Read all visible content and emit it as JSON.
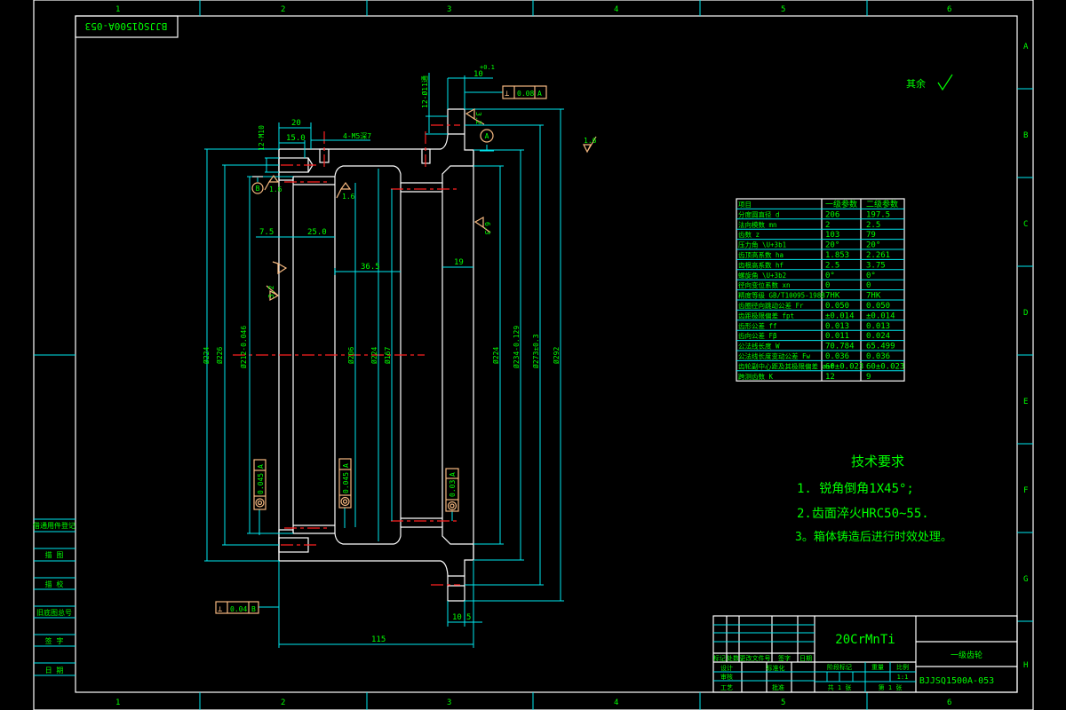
{
  "colors": {
    "text": "#00ff00",
    "dimension": "#00e8f0",
    "outline": "#ffffff",
    "hatch": "#ffff00",
    "centerline": "#ff2020",
    "frame": "#f5b880",
    "background": "#000000"
  },
  "zones": {
    "columns": [
      "1",
      "2",
      "3",
      "4",
      "5",
      "6"
    ],
    "rows": [
      "A",
      "B",
      "C",
      "D",
      "E",
      "F",
      "G",
      "H"
    ]
  },
  "mirrored_code": "BJJSQ1500A-053",
  "roughness_other": {
    "label": "其余",
    "icon": "check-roughness-icon"
  },
  "dimensions": {
    "d20": "20",
    "d15": "15.0",
    "m5": "4-M5深7",
    "m10": "12-M10",
    "d10top": "10",
    "d10tol": "+0.1",
    "holes11": "12-Ø11通",
    "d7_5": "7.5",
    "d25": "25.0",
    "d36_5": "36.5",
    "d19": "19",
    "d115": "115",
    "d10b": "10",
    "d5": "5",
    "dia224a": "Ø224",
    "dia226": "Ø226",
    "dia212": "Ø212-0.046",
    "dia206": "Ø206",
    "dia224b": "Ø224",
    "dia167": "Ø167",
    "dia224c": "Ø224",
    "dia234": "Ø234-0.129",
    "dia273": "Ø273±0.3",
    "dia292": "Ø292"
  },
  "roughness": [
    "3.2",
    "1.6",
    "1.6",
    "6.3",
    "3.2",
    "1.6"
  ],
  "datums": {
    "a": "A",
    "b": "B"
  },
  "tolerances": {
    "perp_top": {
      "symbol": "⊥",
      "value": "0.08",
      "datum": "A"
    },
    "perp_bottom": {
      "symbol": "⊥",
      "value": "0.04",
      "datum": "B"
    },
    "conc1": {
      "symbol": "◎",
      "value": "0.045",
      "datum": "A"
    },
    "conc2": {
      "symbol": "◎",
      "value": "0.045",
      "datum": "A"
    },
    "conc3": {
      "symbol": "◎",
      "value": "0.03",
      "datum": "A"
    }
  },
  "param_table": {
    "headers": [
      "项目",
      "一级参数",
      "二级参数"
    ],
    "rows": [
      [
        "分度圆直径 d",
        "206",
        "197.5"
      ],
      [
        "法向模数 mn",
        "2",
        "2.5"
      ],
      [
        "齿数 z",
        "103",
        "79"
      ],
      [
        "压力角 \\U+3b1",
        "20°",
        "20°"
      ],
      [
        "齿顶高系数 ha",
        "1.853",
        "2.261"
      ],
      [
        "齿根高系数 hf",
        "2.5",
        "3.75"
      ],
      [
        "螺旋角 \\U+3b2",
        "0°",
        "0°"
      ],
      [
        "径向变位系数 xn",
        "0",
        "0"
      ],
      [
        "精度等级 GB/T10095-1988",
        "7HK",
        "7HK"
      ],
      [
        "齿圈径向跳动公差 Fr",
        "0.050",
        "0.050"
      ],
      [
        "齿距极限偏差 fpt",
        "±0.014",
        "±0.014"
      ],
      [
        "齿形公差 ff",
        "0.013",
        "0.013"
      ],
      [
        "齿向公差 Fβ",
        "0.011",
        "0.024"
      ],
      [
        "公法线长度 W",
        "70.784",
        "65.499"
      ],
      [
        "公法线长度变动公差 Fw",
        "0.036",
        "0.036"
      ],
      [
        "齿轮副中心距及其极限偏差 a±f",
        "60±0.023",
        "60±0.023"
      ],
      [
        "跨测齿数 K",
        "12",
        "9"
      ]
    ]
  },
  "tech_requirements": {
    "title": "技术要求",
    "items": [
      "1. 锐角倒角1X45°;",
      "2.齿面淬火HRC50~55.",
      "3。箱体铸造后进行时效处理。"
    ]
  },
  "left_column": [
    "借通用件登记",
    "描 图",
    "描 校",
    "旧底图总号",
    "签 字",
    "日 期"
  ],
  "title_block": {
    "revision_headers": [
      "标记",
      "处数",
      "更改文件号",
      "签字",
      "日期"
    ],
    "design": "设计",
    "standardize": "标准化",
    "review": "审核",
    "process": "工艺",
    "approve": "批准",
    "material": "20CrMnTi",
    "stage_mark": "阶段标记",
    "weight": "重量",
    "scale_label": "比例",
    "scale": "1:1",
    "sheets_total": "共 1 张",
    "sheet_no": "第 1 张",
    "part_name": "一级齿轮",
    "drawing_no": "BJJSQ1500A-053"
  }
}
